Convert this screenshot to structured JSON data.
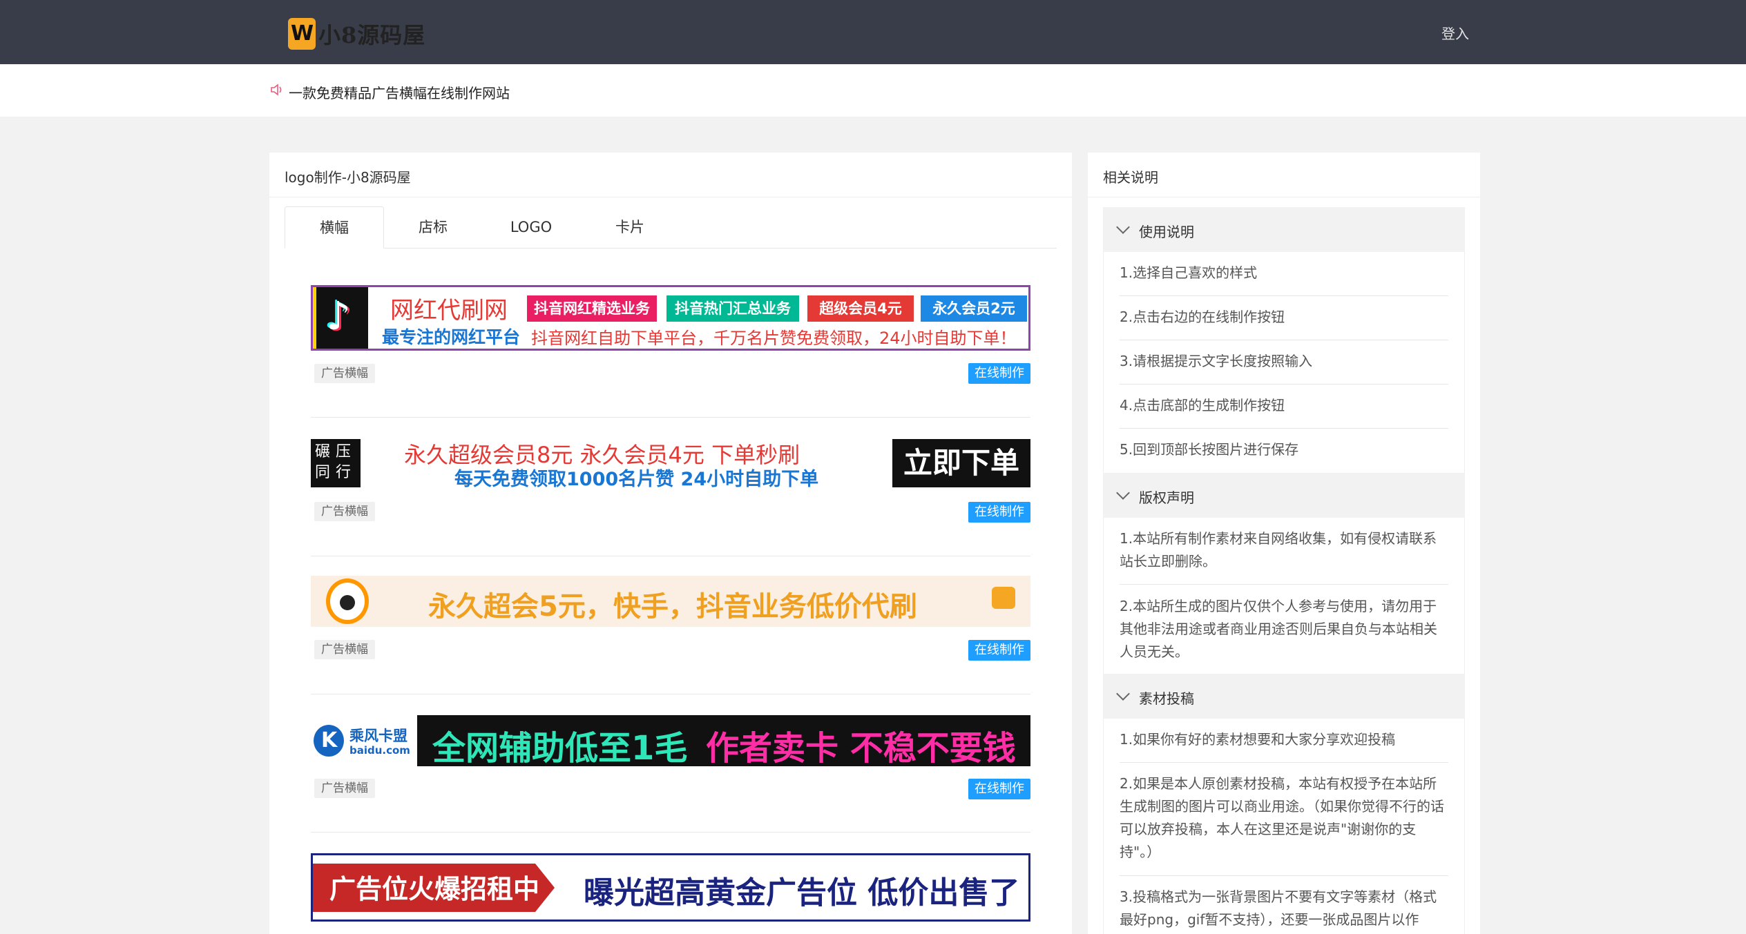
{
  "header": {
    "logo_text": "小8源码屋",
    "login_label": "登入"
  },
  "notice": {
    "icon": "speaker-icon",
    "text": "一款免费精品广告横幅在线制作网站"
  },
  "main": {
    "title": "logo制作-小8源码屋",
    "tabs": [
      {
        "label": "横幅"
      },
      {
        "label": "店标"
      },
      {
        "label": "LOGO"
      },
      {
        "label": "卡片"
      }
    ],
    "active_tab": "横幅",
    "tag_label": "广告横幅",
    "make_label": "在线制作",
    "banners": [
      {
        "title": "网红代刷网",
        "slogan": "最专注的网红平台",
        "desc": "抖音网红自助下单平台，千万名片赞免费领取，24小时自助下单！",
        "chips": [
          "抖音网红精选业务",
          "抖音热门汇总业务",
          "超级会员4元",
          "永久会员2元"
        ]
      },
      {
        "side_text": "碾压同行",
        "line1": "永久超级会员8元  永久会员4元  下单秒刷",
        "line2": "每天免费领取1000名片赞  24小时自助下单",
        "button": "立即下单"
      },
      {
        "text": "永久超会5元，快手，抖音业务低价代刷"
      },
      {
        "brand": "乘风卡盟",
        "brand_sub": "baidu.com",
        "part1": "全网辅助低至1毛",
        "part2": "作者卖卡 不稳不要钱"
      },
      {
        "left": "广告位火爆招租中",
        "right": "曝光超高黄金广告位 低价出售了"
      }
    ]
  },
  "sidebar": {
    "title": "相关说明",
    "sections": [
      {
        "title": "使用说明",
        "items": [
          "1.选择自己喜欢的样式",
          "2.点击右边的在线制作按钮",
          "3.请根据提示文字长度按照输入",
          "4.点击底部的生成制作按钮",
          "5.回到顶部长按图片进行保存"
        ]
      },
      {
        "title": "版权声明",
        "items": [
          "1.本站所有制作素材来自网络收集，如有侵权请联系站长立即删除。",
          "2.本站所生成的图片仅供个人参考与使用，请勿用于其他非法用途或者商业用途否则后果自负与本站相关人员无关。"
        ]
      },
      {
        "title": "素材投稿",
        "items": [
          "1.如果你有好的素材想要和大家分享欢迎投稿",
          "2.如果是本人原创素材投稿，本站有权授予在本站所生成制图的图片可以商业用途。（如果你觉得不行的话可以放弃投稿，本人在这里还是说声\"谢谢你的支持\"。）",
          "3.投稿格式为一张背景图片不要有文字等素材（格式最好png，gif暂不支持），还要一张成品图片以作"
        ]
      }
    ]
  },
  "colors": {
    "header_bg": "#393d49",
    "accent_blue": "#1e9fff"
  }
}
